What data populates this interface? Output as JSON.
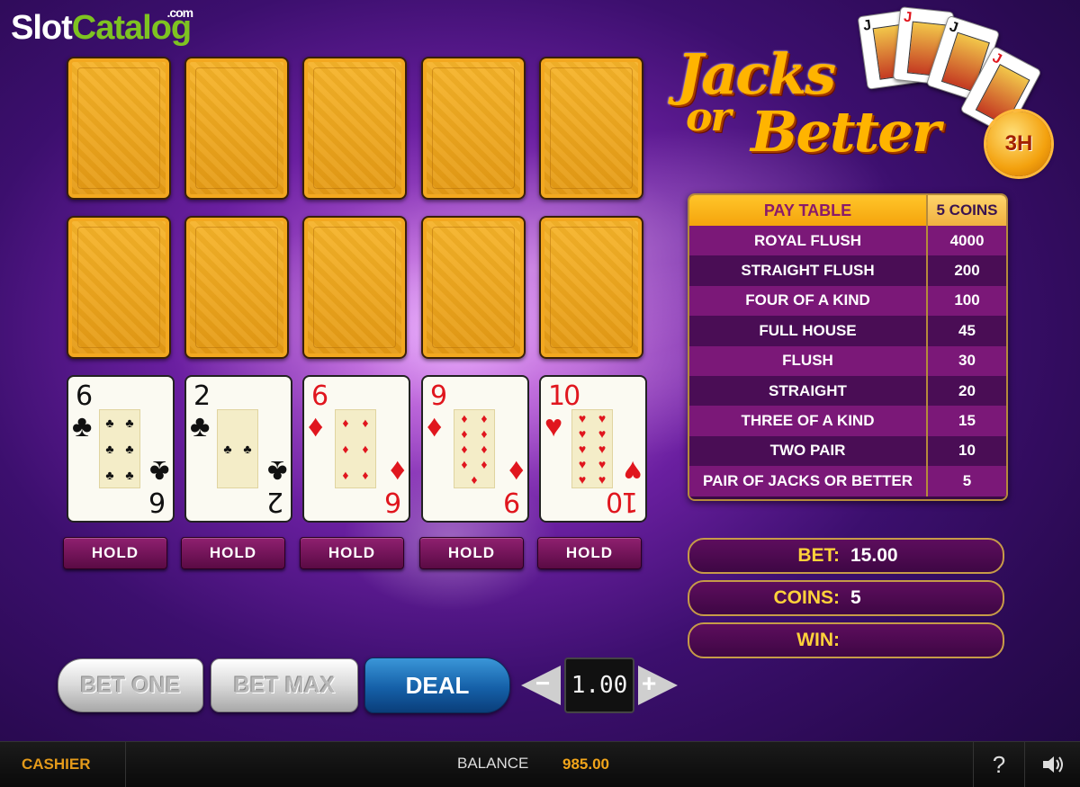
{
  "brand": {
    "slot": "Slot",
    "catalog": "Catalog",
    "com": ".com"
  },
  "title": {
    "line1": "Jacks",
    "line2": "or",
    "line3": "Better",
    "badge": "3H"
  },
  "mini_cards": [
    {
      "rank": "J",
      "suit": "♠"
    },
    {
      "rank": "J",
      "suit": "♥"
    },
    {
      "rank": "J",
      "suit": "♣"
    },
    {
      "rank": "J",
      "suit": "♦"
    }
  ],
  "hands": {
    "back_rows": 2,
    "back_cols": 5
  },
  "cards": [
    {
      "rank": "6",
      "suit": "♣",
      "color": "black",
      "pips": [
        "♣",
        "♣",
        "♣",
        "♣",
        "♣",
        "♣"
      ]
    },
    {
      "rank": "2",
      "suit": "♣",
      "color": "black",
      "pips": [
        "♣",
        "♣"
      ]
    },
    {
      "rank": "6",
      "suit": "♦",
      "color": "red",
      "pips": [
        "♦",
        "♦",
        "♦",
        "♦",
        "♦",
        "♦"
      ]
    },
    {
      "rank": "9",
      "suit": "♦",
      "color": "red",
      "pips": [
        "♦",
        "♦",
        "♦",
        "♦",
        "♦",
        "♦",
        "♦",
        "♦",
        "♦"
      ]
    },
    {
      "rank": "10",
      "suit": "♥",
      "color": "red",
      "pips": [
        "♥",
        "♥",
        "♥",
        "♥",
        "♥",
        "♥",
        "♥",
        "♥",
        "♥",
        "♥"
      ]
    }
  ],
  "hold_buttons": [
    "HOLD",
    "HOLD",
    "HOLD",
    "HOLD",
    "HOLD"
  ],
  "paytable": {
    "header": "PAY TABLE",
    "coins_header": "5 COINS",
    "rows": [
      {
        "hand": "ROYAL FLUSH",
        "pay": "4000"
      },
      {
        "hand": "STRAIGHT FLUSH",
        "pay": "200"
      },
      {
        "hand": "FOUR OF A KIND",
        "pay": "100"
      },
      {
        "hand": "FULL HOUSE",
        "pay": "45"
      },
      {
        "hand": "FLUSH",
        "pay": "30"
      },
      {
        "hand": "STRAIGHT",
        "pay": "20"
      },
      {
        "hand": "THREE OF A KIND",
        "pay": "15"
      },
      {
        "hand": "TWO PAIR",
        "pay": "10"
      },
      {
        "hand": "PAIR OF  JACKS OR BETTER",
        "pay": "5"
      }
    ]
  },
  "info": {
    "bet_label": "BET:",
    "bet_value": "15.00",
    "coins_label": "COINS:",
    "coins_value": "5",
    "win_label": "WIN:",
    "win_value": ""
  },
  "controls": {
    "bet_one": "BET ONE",
    "bet_max": "BET MAX",
    "deal": "DEAL",
    "minus": "−",
    "plus": "+",
    "denom": "1.00"
  },
  "bottom": {
    "cashier": "CASHIER",
    "balance_label": "BALANCE",
    "balance_value": "985.00",
    "help": "?"
  },
  "colors": {
    "accent": "#ffb400",
    "panel": "#4a0d55",
    "deal": "#1560a8",
    "balance": "#f2a51a"
  }
}
